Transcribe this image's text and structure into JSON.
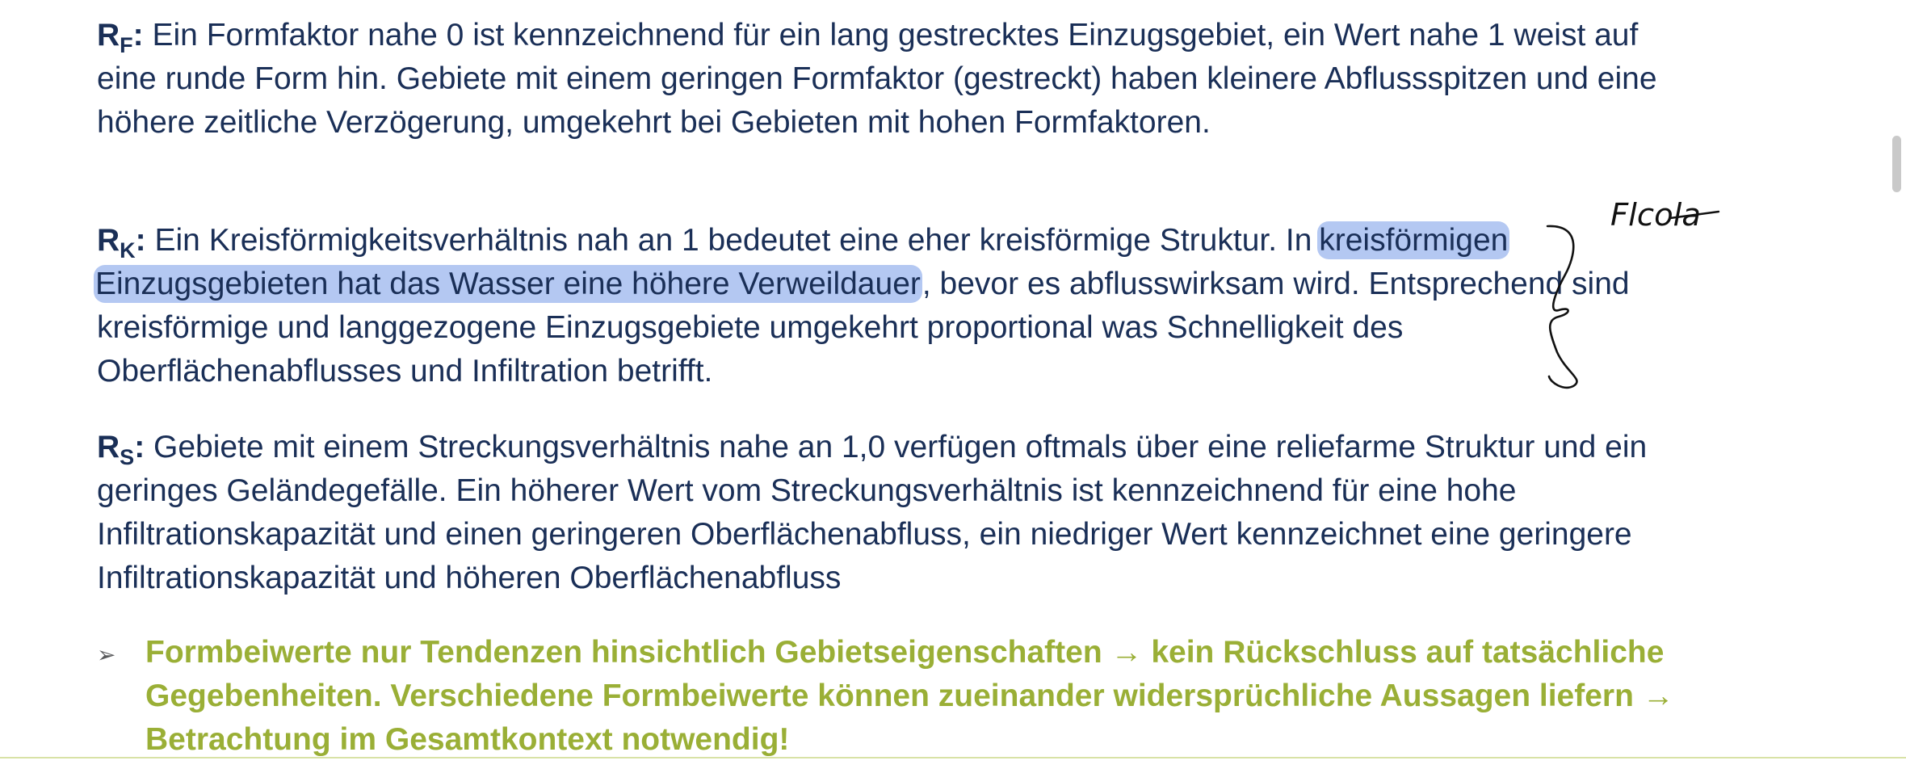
{
  "paragraphs": {
    "rf": {
      "symbol": "R",
      "subscript": "F",
      "colon": ":",
      "text": " Ein Formfaktor nahe 0 ist kennzeichnend für ein lang gestrecktes Einzugsgebiet, ein Wert nahe 1 weist auf eine runde Form hin. Gebiete mit einem geringen Formfaktor (gestreckt) haben kleinere Abflussspitzen und eine höhere zeitliche Verzögerung, umgekehrt bei Gebieten mit hohen Formfaktoren."
    },
    "rk": {
      "symbol": "R",
      "subscript": "K",
      "colon": ":",
      "text_before": " Ein Kreisförmigkeitsverhältnis nah an 1 bedeutet eine eher kreisförmige Struktur. In ",
      "text_highlighted": "kreisförmigen Einzugsgebieten hat das Wasser eine höhere Verweildauer",
      "text_after": ", bevor es abflusswirksam wird. Entsprechend sind kreisförmige und langgezogene Einzugsgebiete umgekehrt proportional was Schnelligkeit des Oberflächenabflusses und Infiltration betrifft."
    },
    "rs": {
      "symbol": "R",
      "subscript": "S",
      "colon": ":",
      "text": " Gebiete mit einem Streckungsverhältnis nahe an 1,0 verfügen oftmals über eine reliefarme Struktur und ein geringes Geländegefälle. Ein höherer Wert vom Streckungsverhältnis ist kennzeichnend für eine hohe Infiltrationskapazität und einen geringeren Oberflächenabfluss, ein niedriger Wert kennzeichnet eine geringere Infiltrationskapazität und höheren Oberflächenabfluss"
    }
  },
  "conclusion": {
    "marker": "➢",
    "text": "Formbeiwerte nur Tendenzen hinsichtlich Gebietseigenschaften → kein Rückschluss auf tatsächliche Gegebenheiten. Verschiedene Formbeiwerte können zueinander widersprüchliche Aussagen liefern → Betrachtung im Gesamtkontext notwendig!"
  },
  "annotation": {
    "handwritten_note": "Flcola",
    "ink_color": "#111111",
    "highlight_color": "#769be8"
  },
  "colors": {
    "body_text": "#1a2f57",
    "conclusion_text": "#9aaf36"
  }
}
